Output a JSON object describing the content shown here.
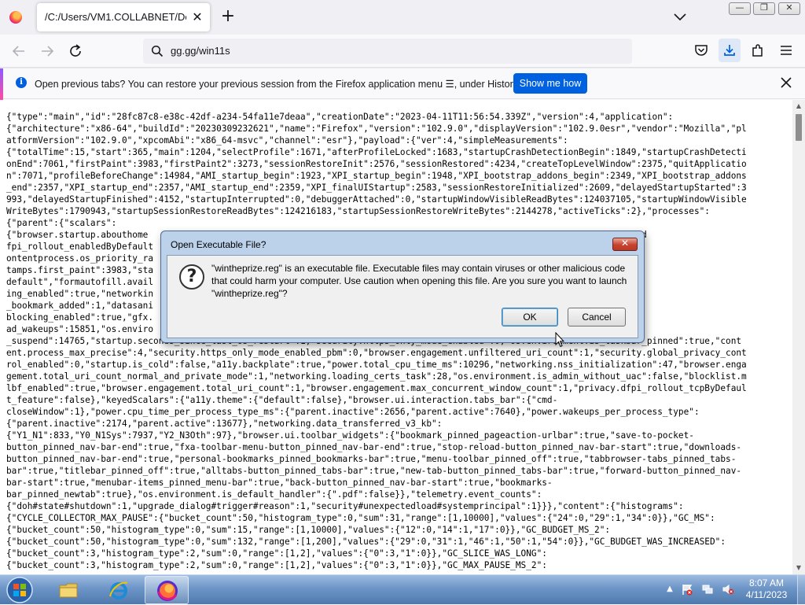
{
  "browser": {
    "tab": {
      "title": "/C:/Users/VM1.COLLABNET/Deskto",
      "close_glyph": "✕"
    },
    "new_tab_glyph": "+",
    "address": "gg.gg/win11s",
    "window_controls": {
      "minimize": "—",
      "maximize": "❐",
      "close": "✕"
    }
  },
  "notification": {
    "text": "Open previous tabs? You can restore your previous session from the Firefox application menu ☰, under History.",
    "button": "Show me how"
  },
  "content_lines": [
    "{\"type\":\"main\",\"id\":\"28fc87c8-e38c-42df-a234-54fa11e7deaa\",\"creationDate\":\"2023-04-11T11:56:54.339Z\",\"version\":4,\"application\":",
    "{\"architecture\":\"x86-64\",\"buildId\":\"20230309232621\",\"name\":\"Firefox\",\"version\":\"102.9.0\",\"displayVersion\":\"102.9.0esr\",\"vendor\":\"Mozilla\",\"pl",
    "atformVersion\":\"102.9.0\",\"xpcomAbi\":\"x86_64-msvc\",\"channel\":\"esr\"},\"payload\":{\"ver\":4,\"simpleMeasurements\":",
    "{\"totalTime\":15,\"start\":365,\"main\":1204,\"selectProfile\":1671,\"afterProfileLocked\":1683,\"startupCrashDetectionBegin\":1849,\"startupCrashDetecti",
    "onEnd\":7061,\"firstPaint\":3983,\"firstPaint2\":3273,\"sessionRestoreInit\":2576,\"sessionRestored\":4234,\"createTopLevelWindow\":2375,\"quitApplicatio",
    "n\":7071,\"profileBeforeChange\":14984,\"AMI_startup_begin\":1923,\"XPI_startup_begin\":1948,\"XPI_bootstrap_addons_begin\":2349,\"XPI_bootstrap_addons",
    "_end\":2357,\"XPI_startup_end\":2357,\"AMI_startup_end\":2359,\"XPI_finalUIStartup\":2583,\"sessionRestoreInitialized\":2609,\"delayedStartupStarted\":3",
    "993,\"delayedStartupFinished\":4152,\"startupInterrupted\":0,\"debuggerAttached\":0,\"startupWindowVisibleReadBytes\":124037105,\"startupWindowVisible",
    "WriteBytes\":1790943,\"startupSessionRestoreReadBytes\":124216183,\"startupSessionRestoreWriteBytes\":2144278,\"activeTicks\":2},\"processes\":",
    "{\"parent\":{\"scalars\":",
    "{\"browser.startup.abouthome                                                                      suspend\":14767,\"privacy.d",
    "fpi_rollout_enabledByDefault                                                                    st_paint_two\":3273,\"dom.c",
    "ontentprocess.os_priority_ra                                                                    sion_exceptions\":0,\"times",
    "tamps.first_paint\":3983,\"sta",
    "default\",\"formautofill.avail                                                                   king.fingerprinting_block",
    "ing_enabled\":true,\"networkin                                                                   agement.bookmarks_toolbar",
    "_bookmark_added\":1,\"datasani                                                                   entblocking.cryptomining_",
    "blocking_enabled\":true,\"gfx.                                                                   icks\":2,\"power.total_thre",
    "ad_wakeups\":15851,\"os.enviro                                                                   nt.session_time_including",
    "_suspend\":14765,\"startup.seconds_since_last_os_restart\":1,\"security.https_only_mode_enabled\":0,\"os.environment.is_taskbar_pinned\":true,\"cont",
    "ent.process_max_precise\":4,\"security.https_only_mode_enabled_pbm\":0,\"browser.engagement.unfiltered_uri_count\":1,\"security.global_privacy_cont",
    "rol_enabled\":0,\"startup.is_cold\":false,\"a11y.backplate\":true,\"power.total_cpu_time_ms\":10296,\"networking.nss_initialization\":47,\"browser.enga",
    "gement.total_uri_count_normal_and_private_mode\":1,\"networking.loading_certs_task\":28,\"os.environment.is_admin_without_uac\":false,\"blocklist.m",
    "lbf_enabled\":true,\"browser.engagement.total_uri_count\":1,\"browser.engagement.max_concurrent_window_count\":1,\"privacy.dfpi_rollout_tcpByDefaul",
    "t_feature\":false},\"keyedScalars\":{\"a11y.theme\":{\"default\":false},\"browser.ui.interaction.tabs_bar\":{\"cmd-",
    "closeWindow\":1},\"power.cpu_time_per_process_type_ms\":{\"parent.inactive\":2656,\"parent.active\":7640},\"power.wakeups_per_process_type\":",
    "{\"parent.inactive\":2174,\"parent.active\":13677},\"networking.data_transferred_v3_kb\":",
    "{\"Y1_N1\":833,\"Y0_N1Sys\":7937,\"Y2_N3Oth\":97},\"browser.ui.toolbar_widgets\":{\"bookmark_pinned_pageaction-urlbar\":true,\"save-to-pocket-",
    "button_pinned_nav-bar-end\":true,\"fxa-toolbar-menu-button_pinned_nav-bar-end\":true,\"stop-reload-button_pinned_nav-bar-start\":true,\"downloads-",
    "button_pinned_nav-bar-end\":true,\"personal-bookmarks_pinned_bookmarks-bar\":true,\"menu-toolbar_pinned_off\":true,\"tabbrowser-tabs_pinned_tabs-",
    "bar\":true,\"titlebar_pinned_off\":true,\"alltabs-button_pinned_tabs-bar\":true,\"new-tab-button_pinned_tabs-bar\":true,\"forward-button_pinned_nav-",
    "bar-start\":true,\"menubar-items_pinned_menu-bar\":true,\"back-button_pinned_nav-bar-start\":true,\"bookmarks-",
    "bar_pinned_newtab\":true},\"os.environment.is_default_handler\":{\".pdf\":false}},\"telemetry.event_counts\":",
    "{\"doh#state#shutdown\":1,\"upgrade_dialog#trigger#reason\":1,\"security#unexpectedload#systemprincipal\":1}}},\"content\":{\"histograms\":",
    "{\"CYCLE_COLLECTOR_MAX_PAUSE\":{\"bucket_count\":50,\"histogram_type\":0,\"sum\":31,\"range\":[1,10000],\"values\":{\"24\":0,\"29\":1,\"34\":0}},\"GC_MS\":",
    "{\"bucket_count\":50,\"histogram_type\":0,\"sum\":15,\"range\":[1,10000],\"values\":{\"12\":0,\"14\":1,\"17\":0}},\"GC_BUDGET_MS_2\":",
    "{\"bucket_count\":50,\"histogram_type\":0,\"sum\":132,\"range\":[1,200],\"values\":{\"29\":0,\"31\":1,\"46\":1,\"50\":1,\"54\":0}},\"GC_BUDGET_WAS_INCREASED\":",
    "{\"bucket_count\":3,\"histogram_type\":2,\"sum\":0,\"range\":[1,2],\"values\":{\"0\":3,\"1\":0}},\"GC_SLICE_WAS_LONG\":",
    "{\"bucket_count\":3,\"histogram_type\":2,\"sum\":0,\"range\":[1,2],\"values\":{\"0\":3,\"1\":0}},\"GC_MAX_PAUSE_MS_2\":"
  ],
  "dialog": {
    "title": "Open Executable File?",
    "close_glyph": "✕",
    "icon_glyph": "?",
    "message": "\"wintheprize.reg\" is an executable file. Executable files may contain viruses or other malicious code that could harm your computer. Use caution when opening this file. Are you sure you want to launch \"wintheprize.reg\"?",
    "ok": "OK",
    "cancel": "Cancel"
  },
  "taskbar": {
    "time": "8:07 AM",
    "date": "4/11/2023"
  }
}
